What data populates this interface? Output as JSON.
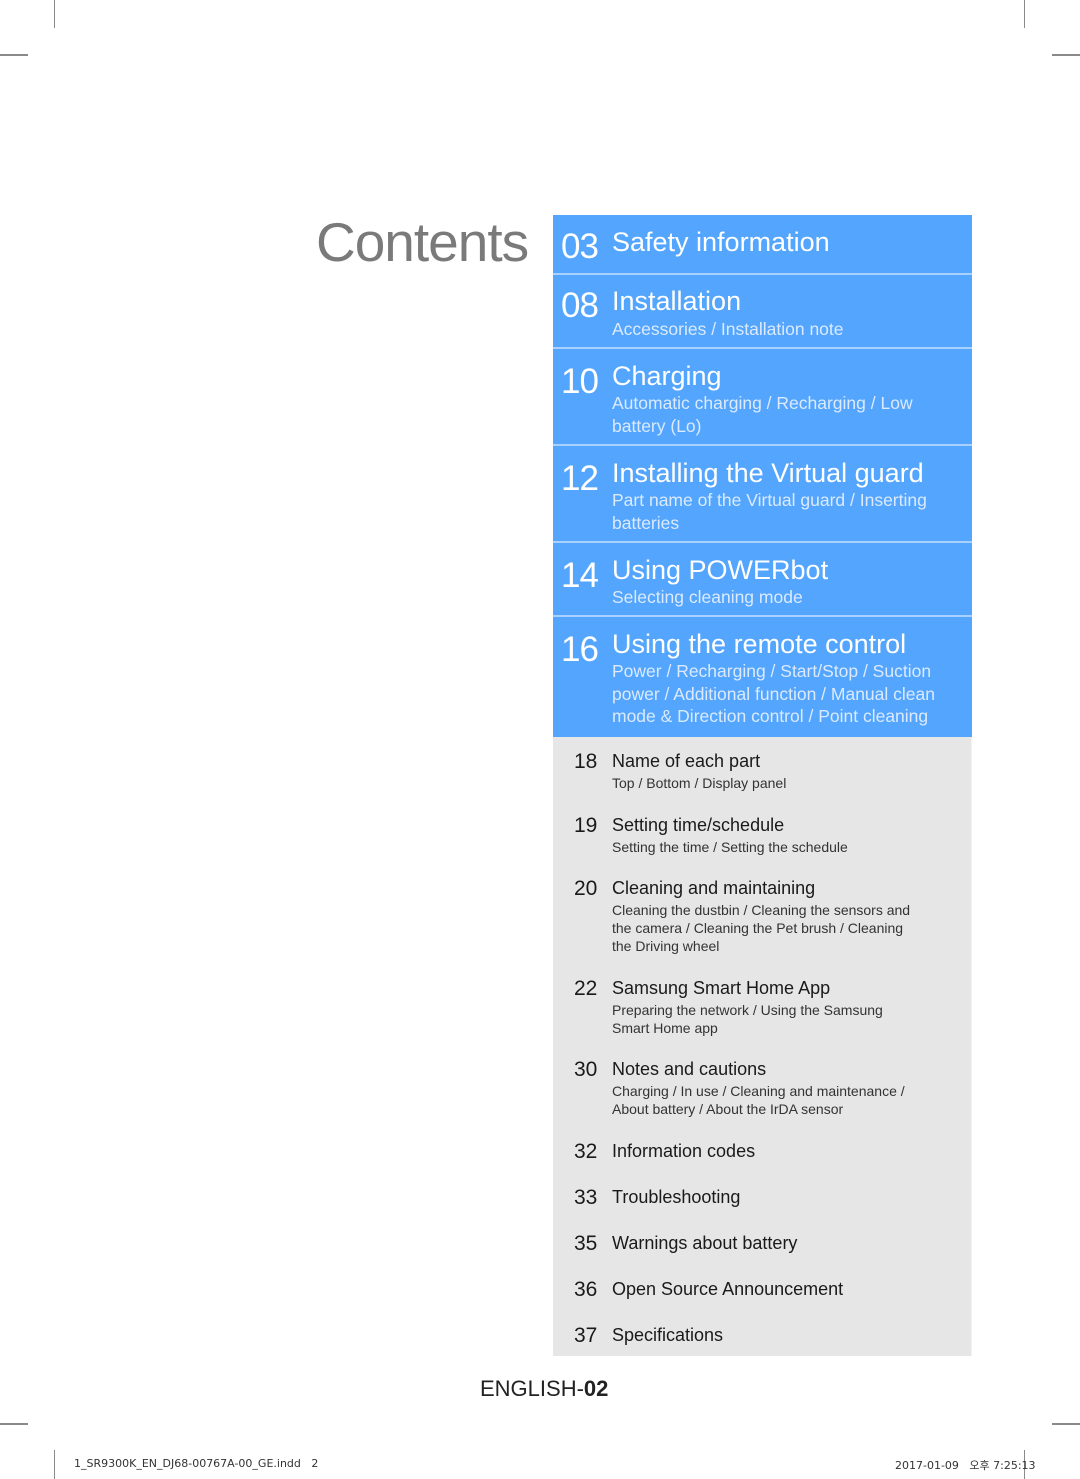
{
  "page": {
    "title": "Contents",
    "footer_label_prefix": "ENGLISH-",
    "footer_page_number": "02",
    "slug_left": "1_SR9300K_EN_DJ68-00767A-00_GE.indd   2",
    "slug_right": "2017-01-09   오후 7:25:13"
  },
  "colors": {
    "primary_section_bg": "#53a5fe",
    "secondary_section_bg": "#e6e6e6",
    "title_gray": "#7a7a7a"
  },
  "primary_sections": [
    {
      "page": "03",
      "title": "Safety information",
      "sub": ""
    },
    {
      "page": "08",
      "title": "Installation",
      "sub": "Accessories / Installation note"
    },
    {
      "page": "10",
      "title": "Charging",
      "sub": "Automatic charging / Recharging / Low battery (Lo)"
    },
    {
      "page": "12",
      "title": "Installing the Virtual guard",
      "sub": "Part name of the Virtual guard / Inserting batteries"
    },
    {
      "page": "14",
      "title": "Using POWERbot",
      "sub": "Selecting cleaning mode"
    },
    {
      "page": "16",
      "title": "Using the remote control",
      "sub": "Power / Recharging / Start/Stop / Suction power / Additional function / Manual clean mode & Direction control / Point cleaning"
    }
  ],
  "secondary_sections": [
    {
      "page": "18",
      "title": "Name of each part",
      "sub": "Top / Bottom / Display panel"
    },
    {
      "page": "19",
      "title": "Setting time/schedule",
      "sub": "Setting the time / Setting the schedule"
    },
    {
      "page": "20",
      "title": "Cleaning and maintaining",
      "sub": "Cleaning the dustbin / Cleaning the sensors and the camera / Cleaning the Pet brush / Cleaning the Driving wheel"
    },
    {
      "page": "22",
      "title": "Samsung Smart Home App",
      "sub": "Preparing the network / Using the Samsung Smart Home app"
    },
    {
      "page": "30",
      "title": "Notes and cautions",
      "sub": "Charging / In use / Cleaning and maintenance / About battery / About the IrDA sensor"
    },
    {
      "page": "32",
      "title": "Information codes",
      "sub": ""
    },
    {
      "page": "33",
      "title": "Troubleshooting",
      "sub": ""
    },
    {
      "page": "35",
      "title": "Warnings about battery",
      "sub": ""
    },
    {
      "page": "36",
      "title": "Open Source Announcement",
      "sub": ""
    },
    {
      "page": "37",
      "title": "Specifications",
      "sub": ""
    }
  ]
}
